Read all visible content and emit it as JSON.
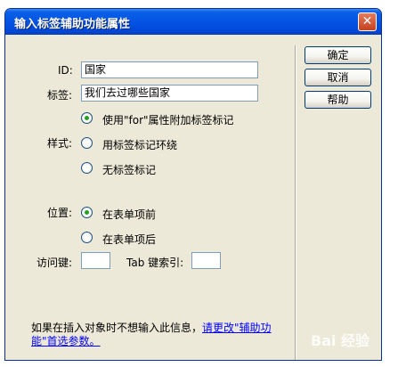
{
  "dialog": {
    "title": "输入标签辅助功能属性",
    "close_symbol": "✕"
  },
  "buttons": {
    "ok": "确定",
    "cancel": "取消",
    "help": "帮助"
  },
  "fields": {
    "id_label": "ID:",
    "id_value": "国家",
    "label_label": "标签:",
    "label_value": "我们去过哪些国家"
  },
  "style": {
    "label": "样式:",
    "options": [
      {
        "label": "使用\"for\"属性附加标签标记",
        "selected": true
      },
      {
        "label": "用标签标记环绕",
        "selected": false
      },
      {
        "label": "无标签标记",
        "selected": false
      }
    ]
  },
  "position": {
    "label": "位置:",
    "options": [
      {
        "label": "在表单项前",
        "selected": true
      },
      {
        "label": "在表单项后",
        "selected": false
      }
    ]
  },
  "access": {
    "access_key_label": "访问键:",
    "access_key_value": "",
    "tab_index_label": "Tab 键索引:",
    "tab_index_value": ""
  },
  "note": {
    "text": "如果在插入对象时不想输入此信息，",
    "link": "请更改\"辅助功能\"首选参数。"
  },
  "watermark": "Bai 经验"
}
